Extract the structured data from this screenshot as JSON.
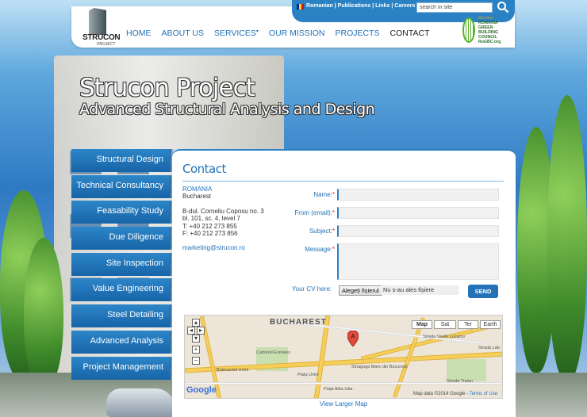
{
  "header": {
    "logo_brand": "STRUCON",
    "logo_sub": "PROJECT",
    "nav": [
      {
        "label": "HOME"
      },
      {
        "label": "ABOUT US"
      },
      {
        "label": "SERVICES"
      },
      {
        "label": "OUR MISSION"
      },
      {
        "label": "PROJECTS"
      },
      {
        "label": "CONTACT"
      }
    ],
    "services_arrow": "▾",
    "top_links": "Romanian | Publications | Links | Careers",
    "search_value": "search in site",
    "rgbc": {
      "member": "Member",
      "line1": "ROMANIA",
      "line2": "GREEN",
      "line3": "BUILDING",
      "line4": "COUNCIL",
      "line5": "RoGBC.org"
    }
  },
  "hero": {
    "title": "Strucon Project",
    "subtitle": "Advanced Structural Analysis and Design"
  },
  "side_menu": [
    "Structural Design",
    "Technical Consultancy",
    "Feasability Study",
    "Due Diligence",
    "Site Inspection",
    "Value Engineering",
    "Steel Detailing",
    "Advanced Analysis",
    "Project Management"
  ],
  "contact": {
    "heading": "Contact",
    "country": "ROMANIA",
    "city": "Bucharest",
    "address1": "B-dul. Corneliu Coposu no. 3",
    "address2": "bl. 101, sc. 4, level 7",
    "phone": "T: +40 212 273 855",
    "fax": "F: +40 212 273 856",
    "email": "marketing@strucon.ro"
  },
  "form": {
    "name_label": "Name:",
    "email_label": "From (email):",
    "subject_label": "Subject:",
    "message_label": "Message:",
    "required_mark": "*",
    "cv_label": "Your CV here:",
    "file_button": "Alegeți fișierul",
    "file_status": "Nu s-au ales fișiere",
    "send_label": "SEND"
  },
  "map": {
    "city_label": "BUCHAREST",
    "types": [
      "Map",
      "Sat",
      "Ter",
      "Earth"
    ],
    "pin_label": "A",
    "google": "Google",
    "copyright": "Map data ©2014 Google - ",
    "terms": "Terms of Use",
    "larger_link": "View Larger Map",
    "street_labels": [
      "Strada Vasile Lucaciu",
      "Piața Unirii",
      "Cartierul Evreiesc",
      "Sinagoga Mare din București",
      "Bulevardul Unirii",
      "Piața Alba Iulia",
      "Strada Traian",
      "Strada Lab"
    ]
  },
  "colors": {
    "brand_blue": "#2372b8",
    "menu_blue": "#1f74b8",
    "topbar_blue": "#2a82c4"
  }
}
